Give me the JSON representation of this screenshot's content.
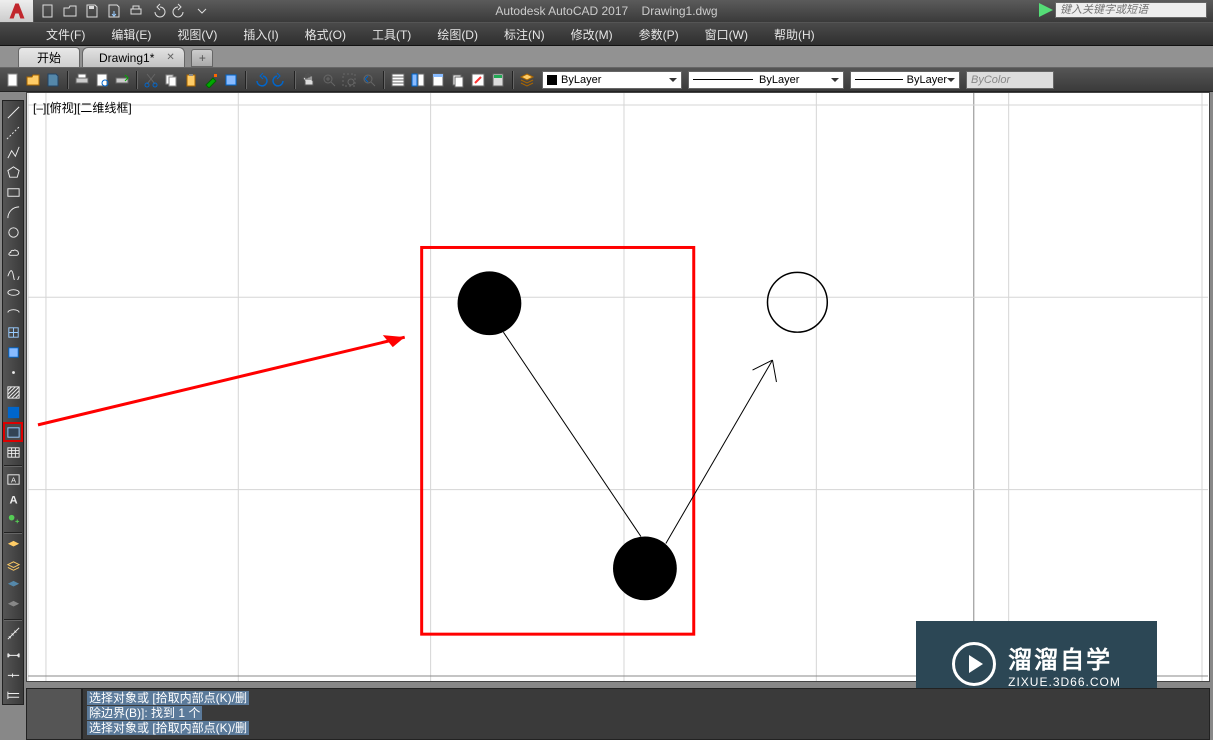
{
  "title": {
    "app": "Autodesk AutoCAD 2017",
    "file": "Drawing1.dwg"
  },
  "search": {
    "placeholder": "键入关键字或短语"
  },
  "menus": [
    "文件(F)",
    "编辑(E)",
    "视图(V)",
    "插入(I)",
    "格式(O)",
    "工具(T)",
    "绘图(D)",
    "标注(N)",
    "修改(M)",
    "参数(P)",
    "窗口(W)",
    "帮助(H)"
  ],
  "tabs": {
    "start": "开始",
    "file": "Drawing1*",
    "add": "+"
  },
  "viewlabel": "[–][俯视][二维线框]",
  "layer_dd": {
    "text": "ByLayer"
  },
  "linetype_dd": {
    "text": "ByLayer"
  },
  "lineweight_dd": {
    "text": "ByLayer"
  },
  "color_dd": {
    "text": "ByColor"
  },
  "cmd": {
    "line1": "选择对象或 [拾取内部点(K)/删",
    "line2": "除边界(B)]: 找到 1 个",
    "line3": "选择对象或 [拾取内部点(K)/删"
  },
  "watermark": {
    "big": "溜溜自学",
    "small": "ZIXUE.3D66.COM"
  }
}
